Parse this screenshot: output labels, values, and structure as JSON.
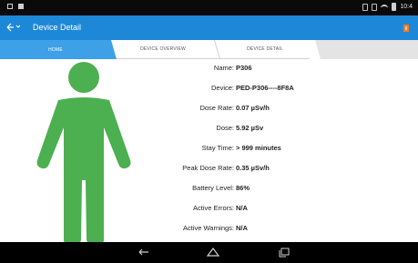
{
  "status_bar": {
    "time": "10:4"
  },
  "app_bar": {
    "title": "Device Detail"
  },
  "tabs": [
    {
      "label": "HOME"
    },
    {
      "label": "DEVICE OVERVIEW"
    },
    {
      "label": "DEVICE DETAIL"
    }
  ],
  "details": [
    {
      "label": "Name:",
      "value": "P306"
    },
    {
      "label": "Device:",
      "value": "PED-P306----8F8A"
    },
    {
      "label": "Dose Rate:",
      "value": "0.07 µSv/h"
    },
    {
      "label": "Dose:",
      "value": "5.92 µSv"
    },
    {
      "label": "Stay Time:",
      "value": "> 999 minutes"
    },
    {
      "label": "Peak Dose Rate:",
      "value": "0.35 µSv/h"
    },
    {
      "label": "Battery Level:",
      "value": "86%"
    },
    {
      "label": "Active Errors:",
      "value": "N/A"
    },
    {
      "label": "Active Warnings:",
      "value": "N/A"
    }
  ],
  "colors": {
    "app_bar": "#1e88d8",
    "active_tab": "#3ea0e6",
    "figure_status": "#4caf50",
    "action_icon": "#f07a2a"
  },
  "icons": {
    "back": "back-arrow-icon",
    "action": "alert-icon",
    "figure": "person-status-icon",
    "nav_back": "nav-back-icon",
    "nav_home": "nav-home-icon",
    "nav_recents": "nav-recents-icon"
  }
}
